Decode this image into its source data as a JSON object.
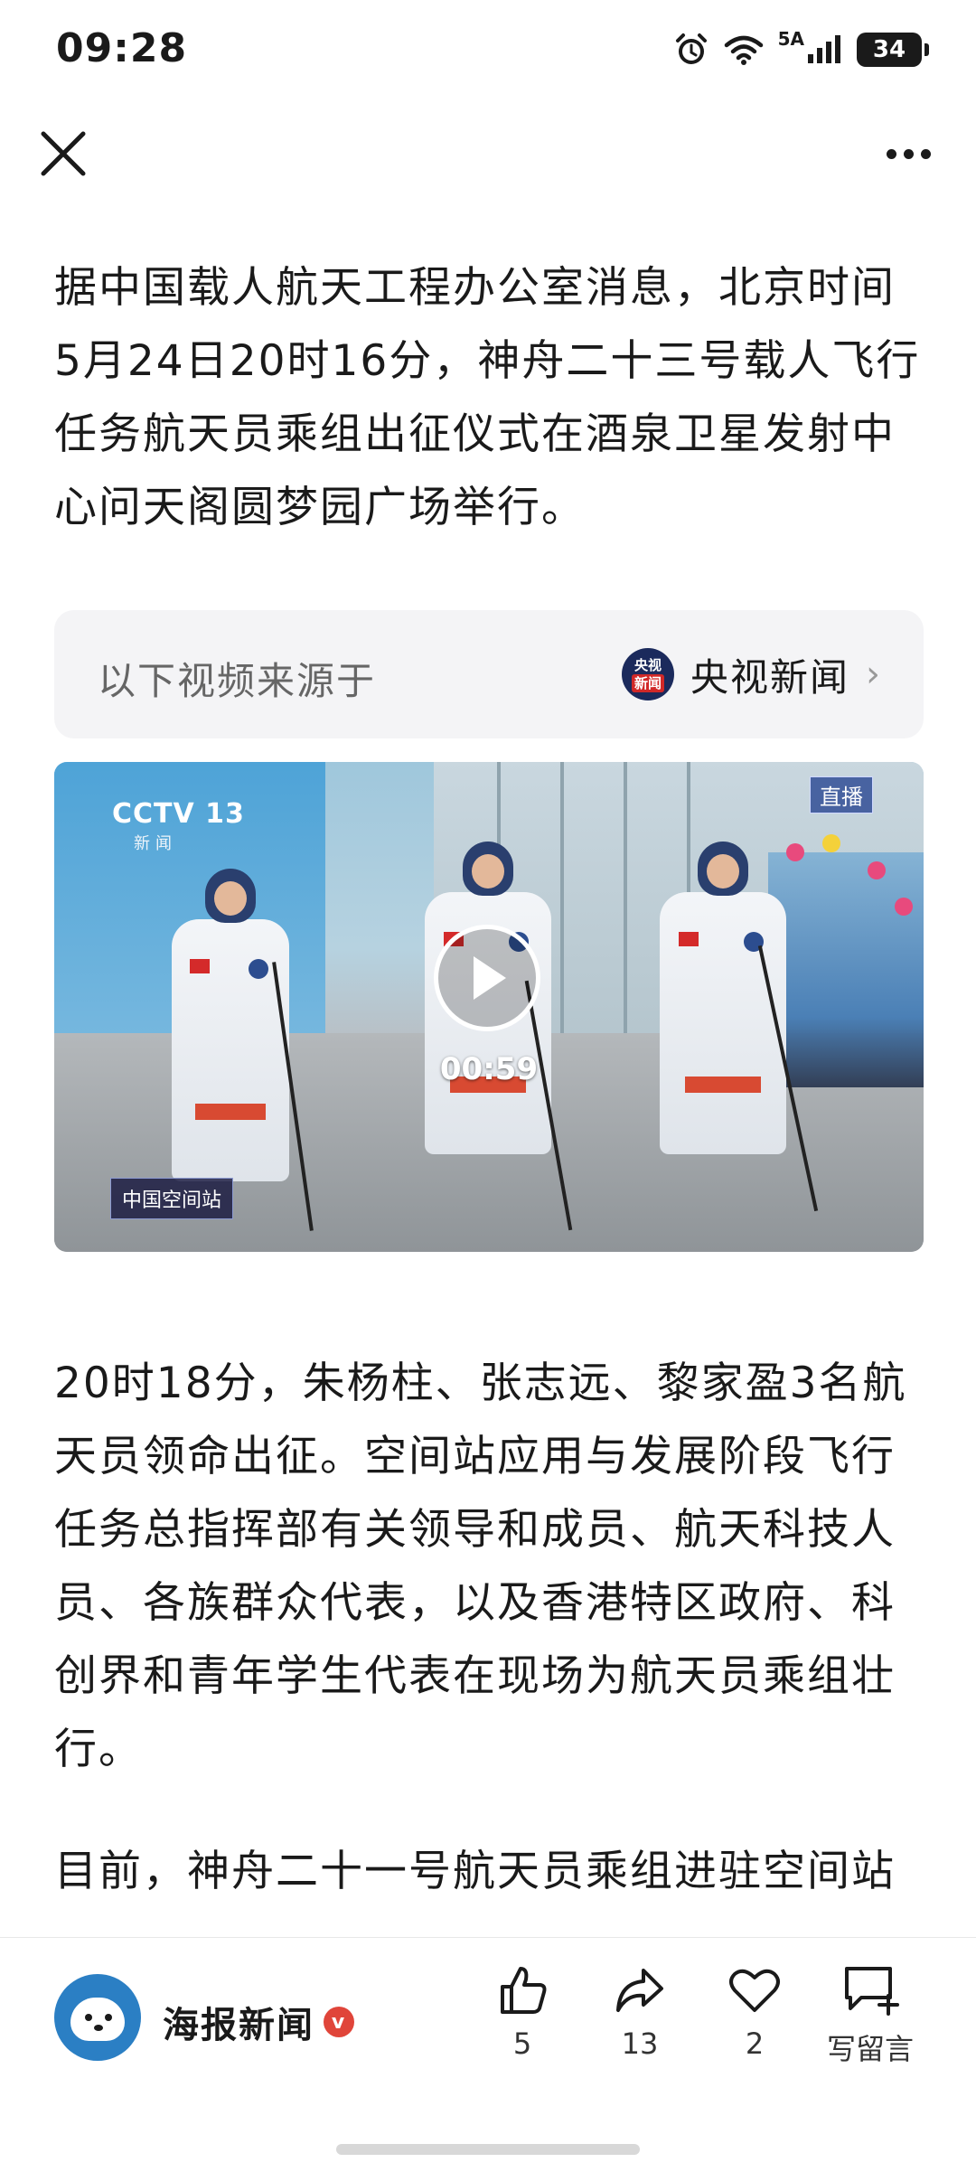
{
  "status_bar": {
    "time": "09:28",
    "network": "5A",
    "battery": "34",
    "icons": [
      "alarm-icon",
      "wifi-icon",
      "signal-icon",
      "battery-icon"
    ]
  },
  "nav": {
    "close_icon": "close-icon",
    "more_icon": "more-icon"
  },
  "article": {
    "paragraph_1": "据中国载人航天工程办公室消息，北京时间5月24日20时16分，神舟二十三号载人飞行任务航天员乘组出征仪式在酒泉卫星发射中心问天阁圆梦园广场举行。",
    "source_card": {
      "label": "以下视频来源于",
      "source_name": "央视新闻",
      "logo_line1": "央视",
      "logo_line2": "新闻"
    },
    "video": {
      "channel_logo": "CCTV 13",
      "channel_sub": "新闻",
      "live_badge": "直播",
      "station_badge": "中国空间站",
      "duration": "00:59"
    },
    "paragraph_2": "20时18分，朱杨柱、张志远、黎家盈3名航天员领命出征。空间站应用与发展阶段飞行任务总指挥部有关领导和成员、航天科技人员、各族群众代表，以及香港特区政府、科创界和青年学生代表在现场为航天员乘组壮行。",
    "paragraph_3": "目前，神舟二十一号航天员乘组进驻空间站"
  },
  "bottom_bar": {
    "author_name": "海报新闻",
    "verified_badge": "v",
    "like_count": "5",
    "share_count": "13",
    "favorite_count": "2",
    "comment_label": "写留言"
  },
  "colors": {
    "text": "#1a1a1a",
    "muted": "#666666",
    "card_bg": "#f4f4f6",
    "verified": "#e0453a",
    "avatar": "#2b7fc4"
  }
}
